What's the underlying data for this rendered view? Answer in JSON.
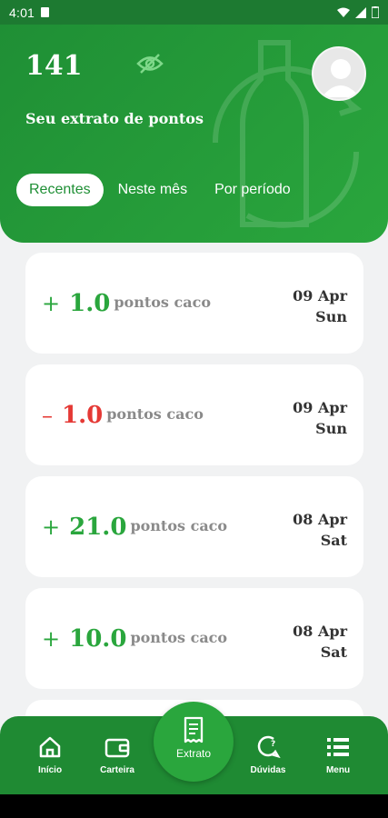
{
  "status": {
    "time": "4:01"
  },
  "header": {
    "points": "141",
    "subtitle": "Seu extrato de pontos",
    "tabs": [
      {
        "label": "Recentes",
        "active": true
      },
      {
        "label": "Neste mês",
        "active": false
      },
      {
        "label": "Por período",
        "active": false
      }
    ]
  },
  "transactions": [
    {
      "sign": "+",
      "value": "1.0",
      "unit": "pontos caco",
      "date": "09 Apr",
      "weekday": "Sun",
      "type": "credit"
    },
    {
      "sign": "–",
      "value": "1.0",
      "unit": "pontos caco",
      "date": "09 Apr",
      "weekday": "Sun",
      "type": "debit"
    },
    {
      "sign": "+",
      "value": "21.0",
      "unit": "pontos caco",
      "date": "08 Apr",
      "weekday": "Sat",
      "type": "credit"
    },
    {
      "sign": "+",
      "value": "10.0",
      "unit": "pontos caco",
      "date": "08 Apr",
      "weekday": "Sat",
      "type": "credit"
    }
  ],
  "nav": {
    "inicio": "Início",
    "carteira": "Carteira",
    "extrato": "Extrato",
    "duvidas": "Dúvidas",
    "menu": "Menu"
  },
  "colors": {
    "primary": "#1f8f35",
    "accent": "#2aa63d",
    "negative": "#e53935"
  }
}
